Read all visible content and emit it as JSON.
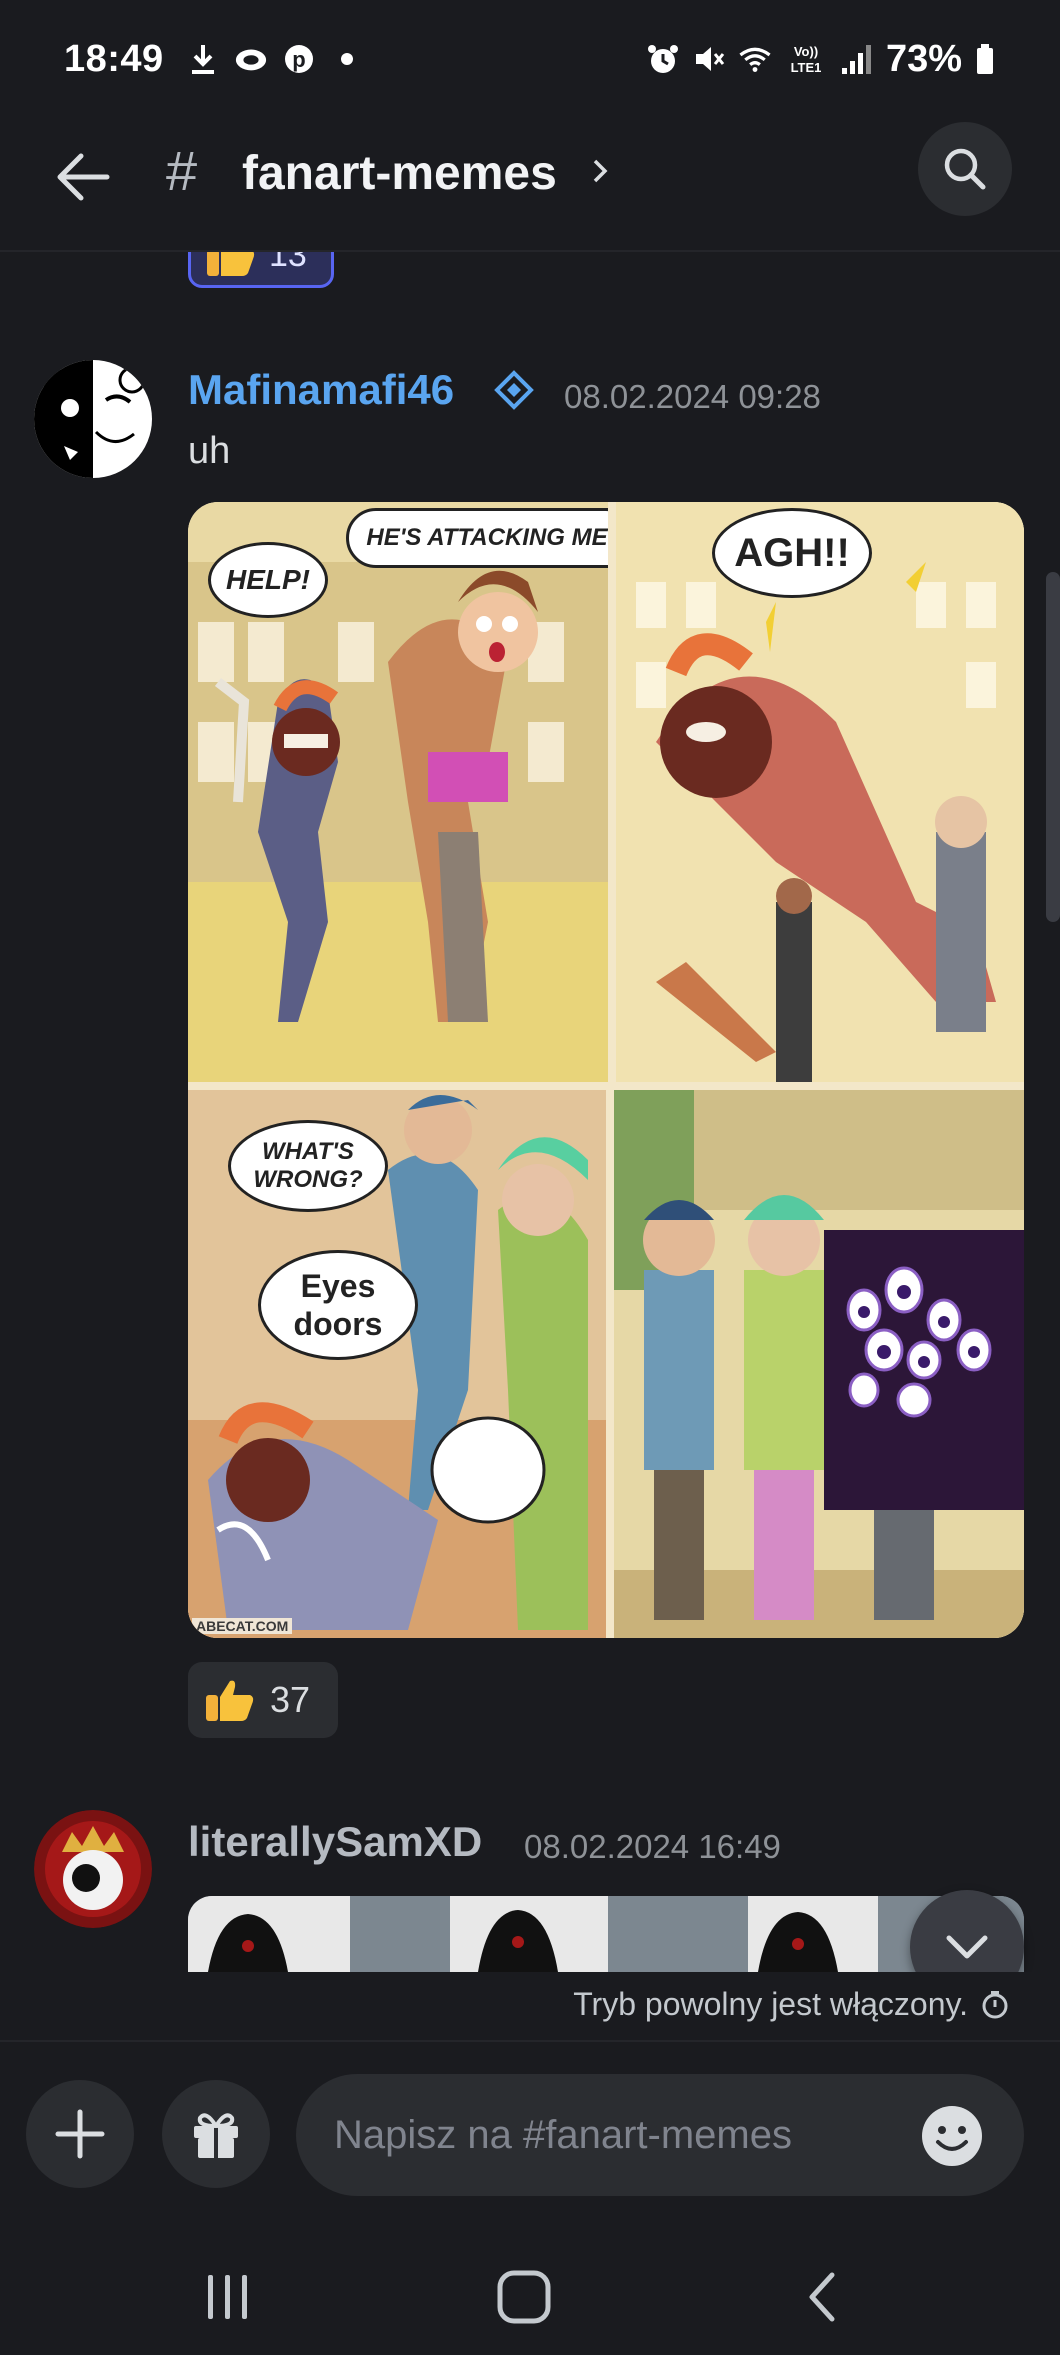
{
  "status_bar": {
    "time": "18:49",
    "battery_text": "73%",
    "left_icons": [
      "download-icon",
      "cloud-icon",
      "pinterest-icon",
      "dot-icon"
    ],
    "right_icons": [
      "alarm-icon",
      "mute-icon",
      "wifi-icon",
      "volte-icon",
      "signal-icon",
      "battery-icon"
    ],
    "volte_label": "Vo)) LTE1"
  },
  "header": {
    "hash": "#",
    "channel_name": "fanart-memes",
    "chevron": "›"
  },
  "previous_reaction": {
    "emoji": "thumbs-up",
    "count": "13"
  },
  "messages": [
    {
      "author": "Mafinamafi46",
      "author_color": "#5aa5f0",
      "timestamp": "08.02.2024 09:28",
      "text": "uh",
      "comic": {
        "speech": [
          "HELP!",
          "HE'S ATTACKING ME!",
          "AGH!!",
          "WHAT'S WRONG?",
          "Eyes doors"
        ],
        "watermark": "ABECAT.COM"
      },
      "reaction": {
        "emoji": "thumbs-up",
        "count": "37"
      }
    },
    {
      "author": "literallySamXD",
      "author_color": "#b5bac1",
      "timestamp": "08.02.2024 16:49"
    }
  ],
  "slowmode_text": "Tryb powolny jest włączony.",
  "composer": {
    "placeholder": "Napisz na #fanart-memes"
  },
  "colors": {
    "background": "#1a1b1f",
    "surface": "#2b2d31",
    "accent": "#5865f2"
  }
}
